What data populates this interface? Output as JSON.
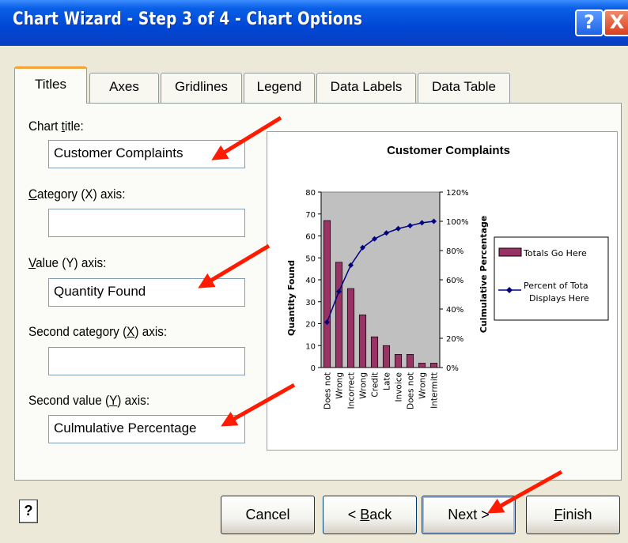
{
  "window": {
    "title": "Chart Wizard - Step 3 of 4 - Chart Options",
    "help_glyph": "?",
    "close_glyph": "X"
  },
  "tabs": [
    {
      "label": "Titles",
      "active": true
    },
    {
      "label": "Axes",
      "active": false
    },
    {
      "label": "Gridlines",
      "active": false
    },
    {
      "label": "Legend",
      "active": false
    },
    {
      "label": "Data Labels",
      "active": false
    },
    {
      "label": "Data Table",
      "active": false
    }
  ],
  "fields": {
    "chart_title": {
      "label_pre": "Chart ",
      "label_accel": "t",
      "label_post": "itle:",
      "value": "Customer Complaints"
    },
    "category_x": {
      "label_pre": "",
      "label_accel": "C",
      "label_post": "ategory (X) axis:",
      "value": ""
    },
    "value_y": {
      "label_pre": "",
      "label_accel": "V",
      "label_post": "alue (Y) axis:",
      "value": "Quantity Found"
    },
    "second_category_x": {
      "label_pre": "Second category (",
      "label_accel": "X",
      "label_post": ") axis:",
      "value": ""
    },
    "second_value_y": {
      "label_pre": "Second value (",
      "label_accel": "Y",
      "label_post": ") axis:",
      "value": "Culmulative Percentage"
    }
  },
  "chart_data": {
    "type": "bar",
    "title": "Customer Complaints",
    "ylabel": "Quantity Found",
    "y2label": "Culmulative Percentage",
    "categories": [
      "Does not",
      "Wrong",
      "Incorrect",
      "Wrong",
      "Credit",
      "Late",
      "Invoice",
      "Does not",
      "Wrong",
      "Intermitt"
    ],
    "ylim": [
      0,
      80
    ],
    "yticks": [
      "0",
      "10",
      "20",
      "30",
      "40",
      "50",
      "60",
      "70",
      "80"
    ],
    "y2lim": [
      0,
      120
    ],
    "y2ticks": [
      "0%",
      "20%",
      "40%",
      "60%",
      "80%",
      "100%",
      "120%"
    ],
    "series": [
      {
        "name": "Totals Go Here",
        "type": "bar",
        "color": "#993366",
        "values": [
          67,
          48,
          36,
          24,
          14,
          10,
          6,
          6,
          2,
          2
        ]
      },
      {
        "name": "Percent of Tota Displays Here",
        "type": "line",
        "color": "#000080",
        "values": [
          31,
          52,
          70,
          82,
          88,
          92,
          95,
          97,
          99,
          100
        ]
      }
    ],
    "plot_background": "#c0c0c0",
    "legend_position": "right"
  },
  "buttons": {
    "cancel": "Cancel",
    "back_pre": "< ",
    "back_accel": "B",
    "back_post": "ack",
    "next": "Next >",
    "finish_accel": "F",
    "finish_post": "inish"
  },
  "colors": {
    "titlebar": "#0046d5",
    "accent_arrow": "#ff1a00",
    "dialog_bg": "#ece9d8"
  }
}
